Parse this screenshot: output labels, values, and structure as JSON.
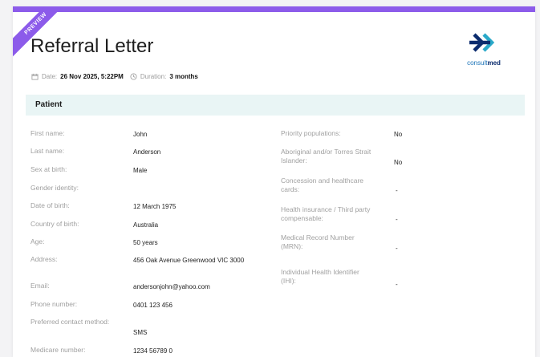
{
  "title": "Referral Letter",
  "ribbon": "PREVIEW",
  "meta": {
    "date_label": "Date:",
    "date_value": "26 Nov 2025, 5:22PM",
    "duration_label": "Duration:",
    "duration_value": "3 months"
  },
  "logo": {
    "text_light": "consult",
    "text_bold": "med",
    "color_primary": "#0b2c6e",
    "color_accent": "#2aa9c9"
  },
  "section": "Patient",
  "left_fields": [
    {
      "label": "First name:",
      "value": "John"
    },
    {
      "label": "Last name:",
      "value": "Anderson"
    },
    {
      "label": "Sex at birth:",
      "value": "Male"
    },
    {
      "label": "Gender identity:",
      "value": ""
    },
    {
      "label": "Date of birth:",
      "value": "12 March 1975"
    },
    {
      "label": "Country of birth:",
      "value": "Australia"
    },
    {
      "label": "Age:",
      "value": "50 years"
    },
    {
      "label": "Address:",
      "value": "456 Oak Avenue Greenwood VIC 3000"
    },
    {
      "label": "Email:",
      "value": "andersonjohn@yahoo.com"
    },
    {
      "label": "Phone number:",
      "value": "0401 123 456"
    },
    {
      "label": "Preferred contact method:",
      "value": "SMS"
    },
    {
      "label": "Medicare number:",
      "value": "1234 56789 0"
    }
  ],
  "right_fields": [
    {
      "label": "Priority populations:",
      "value": "No"
    },
    {
      "label": "Aboriginal and/or Torres Strait Islander:",
      "value": "No"
    },
    {
      "label": "Concession and healthcare cards:",
      "value": "-"
    },
    {
      "label": "Health insurance / Third party compensable:",
      "value": "-"
    },
    {
      "label": "Medical Record Number (MRN):",
      "value": "-"
    },
    {
      "label": "Individual Health Identifier (IHI):",
      "value": "-"
    }
  ],
  "colors": {
    "accent": "#8c5bea",
    "section_bg": "#e9f5f5"
  }
}
